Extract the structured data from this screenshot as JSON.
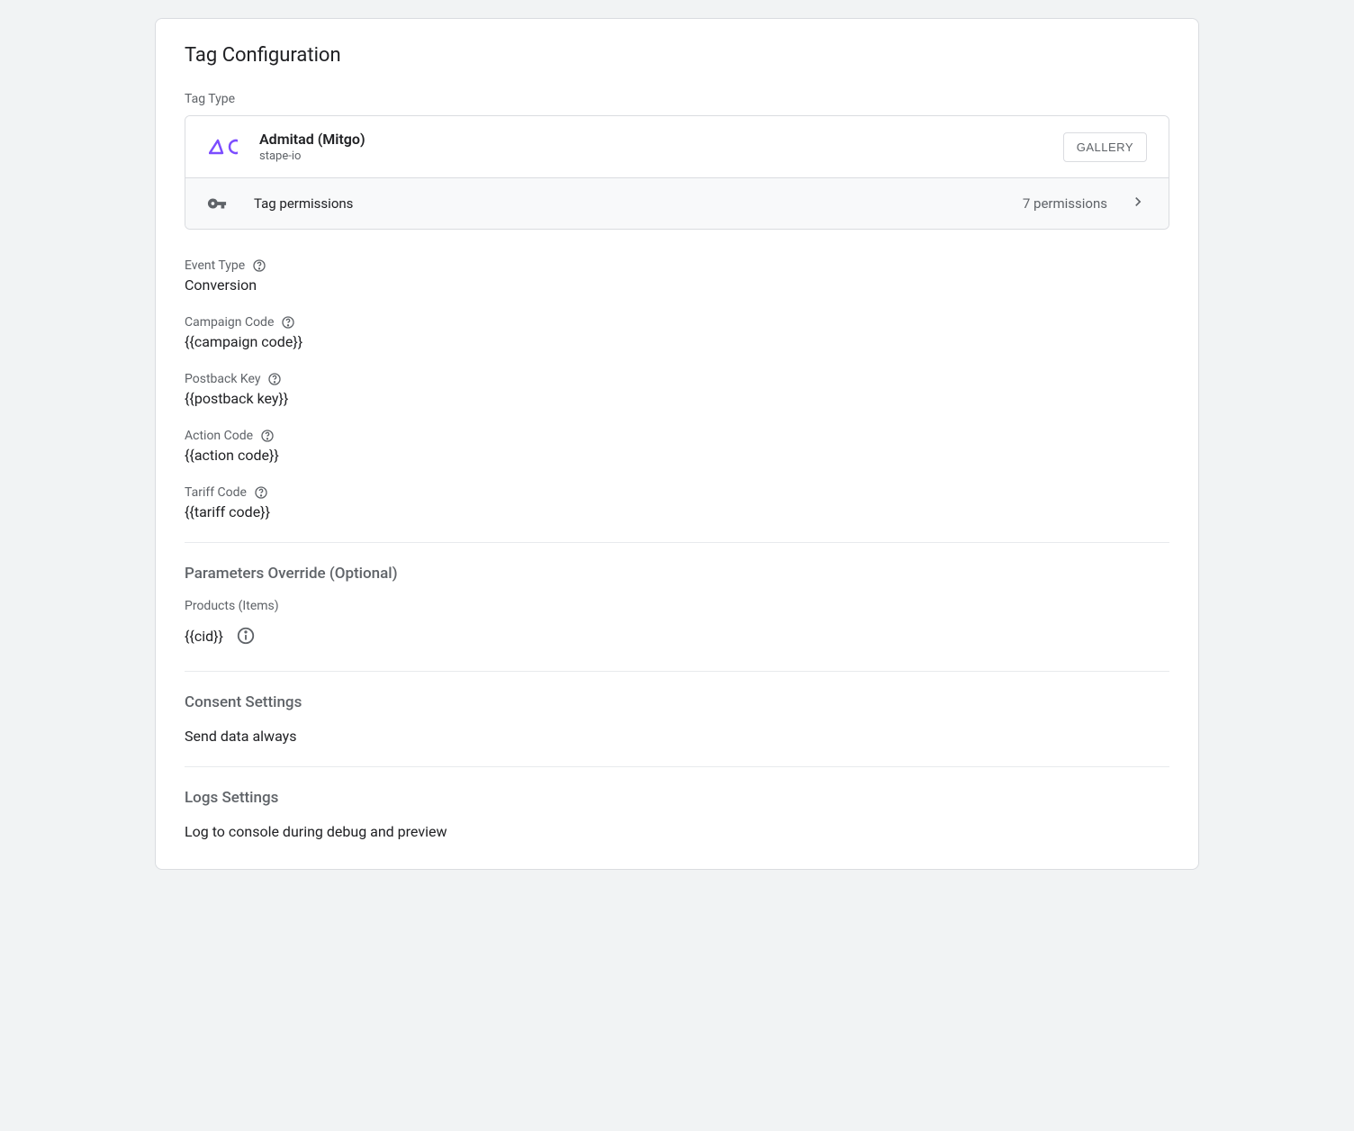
{
  "title": "Tag Configuration",
  "tag_type_label": "Tag Type",
  "tag": {
    "name": "Admitad (Mitgo)",
    "author": "stape-io",
    "gallery_btn": "GALLERY"
  },
  "permissions": {
    "label": "Tag permissions",
    "count_text": "7 permissions"
  },
  "fields": {
    "event_type": {
      "label": "Event Type",
      "value": "Conversion"
    },
    "campaign_code": {
      "label": "Campaign Code",
      "value": "{{campaign code}}"
    },
    "postback_key": {
      "label": "Postback Key",
      "value": "{{postback key}}"
    },
    "action_code": {
      "label": "Action Code",
      "value": "{{action code}}"
    },
    "tariff_code": {
      "label": "Tariff Code",
      "value": "{{tariff code}}"
    }
  },
  "parameters_override": {
    "title": "Parameters Override (Optional)",
    "products_label": "Products (Items)",
    "cid_value": "{{cid}}"
  },
  "consent": {
    "title": "Consent Settings",
    "value": "Send data always"
  },
  "logs": {
    "title": "Logs Settings",
    "value": "Log to console during debug and preview"
  }
}
